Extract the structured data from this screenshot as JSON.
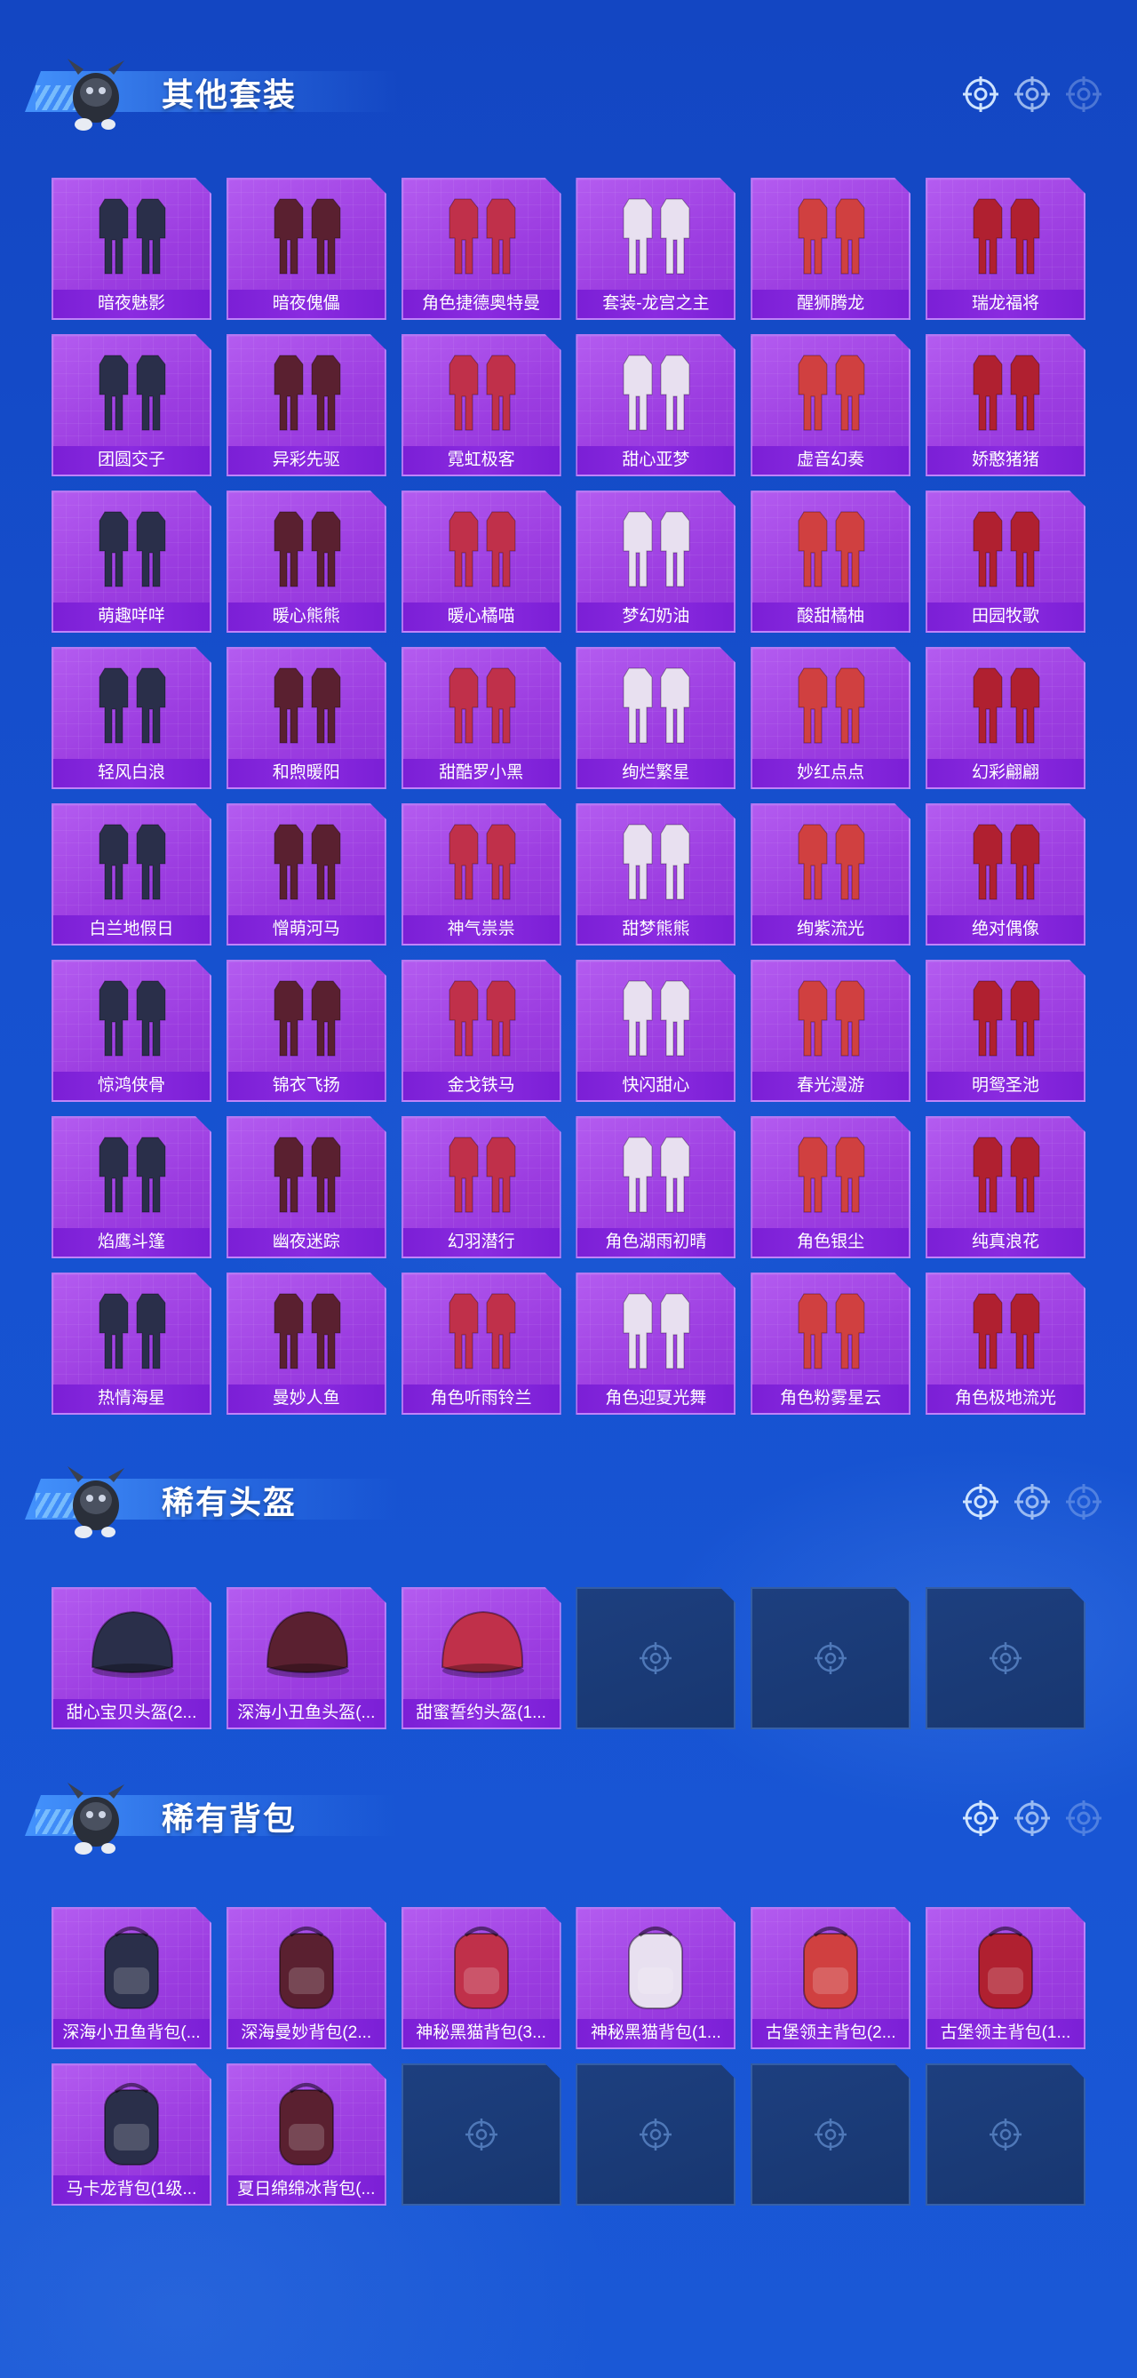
{
  "colors": {
    "background": "#1651cf",
    "card_purple": "#9b3ce0",
    "label_purple": "#7b1fd6",
    "empty_slot": "#1d3f7f"
  },
  "sections": [
    {
      "title": "其他套装",
      "items": [
        "暗夜魅影",
        "暗夜傀儡",
        "角色捷德奥特曼",
        "套装-龙宫之主",
        "醒狮腾龙",
        "瑞龙福将",
        "团圆交子",
        "异彩先驱",
        "霓虹极客",
        "甜心亚梦",
        "虚音幻奏",
        "娇憨猪猪",
        "萌趣咩咩",
        "暖心熊熊",
        "暖心橘喵",
        "梦幻奶油",
        "酸甜橘柚",
        "田园牧歌",
        "轻风白浪",
        "和煦暖阳",
        "甜酷罗小黑",
        "绚烂繁星",
        "妙红点点",
        "幻彩翩翩",
        "白兰地假日",
        "憎萌河马",
        "神气祟祟",
        "甜梦熊熊",
        "绚紫流光",
        "绝对偶像",
        "惊鸿侠骨",
        "锦衣飞扬",
        "金戈铁马",
        "快闪甜心",
        "春光漫游",
        "明鸳圣池",
        "焰鹰斗篷",
        "幽夜迷踪",
        "幻羽潜行",
        "角色湖雨初晴",
        "角色银尘",
        "纯真浪花",
        "热情海星",
        "曼妙人鱼",
        "角色听雨铃兰",
        "角色迎夏光舞",
        "角色粉雾星云",
        "角色极地流光"
      ],
      "empty_slots": 0
    },
    {
      "title": "稀有头盔",
      "items": [
        "甜心宝贝头盔(2...",
        "深海小丑鱼头盔(...",
        "甜蜜誓约头盔(1..."
      ],
      "empty_slots": 3
    },
    {
      "title": "稀有背包",
      "items": [
        "深海小丑鱼背包(...",
        "深海曼妙背包(2...",
        "神秘黑猫背包(3...",
        "神秘黑猫背包(1...",
        "古堡领主背包(2...",
        "古堡领主背包(1...",
        "马卡龙背包(1级...",
        "夏日绵绵冰背包(..."
      ],
      "empty_slots": 4
    }
  ]
}
